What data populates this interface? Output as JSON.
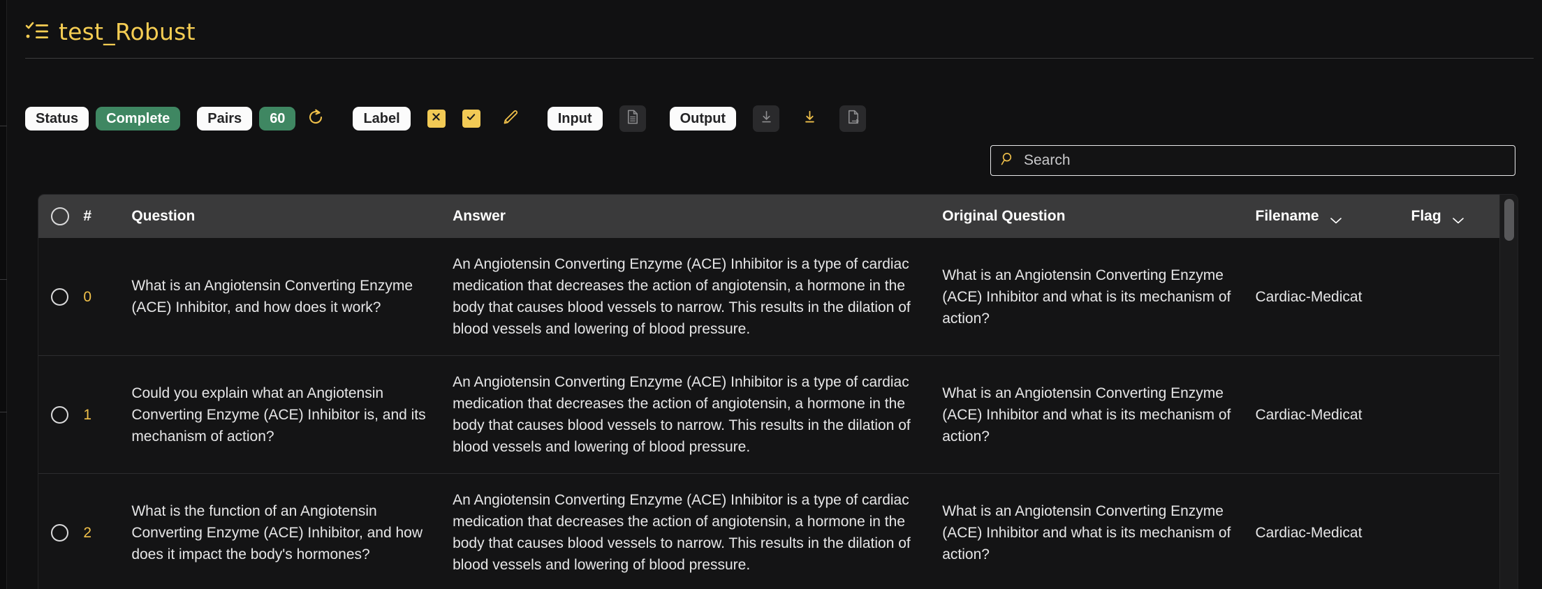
{
  "app": {
    "title": "test_Robust",
    "title_icon": "task-list-icon",
    "accent_yellow": "#f5cd53",
    "accent_green": "#3f8762",
    "background": "#111112"
  },
  "toolbar": {
    "status_label": "Status",
    "status_value": "Complete",
    "pairs_label": "Pairs",
    "pairs_value": "60",
    "refresh_icon": "refresh-icon",
    "label_label": "Label",
    "reject_icon": "cross-icon",
    "accept_icon": "check-icon",
    "edit_icon": "pencil-icon",
    "input_label": "Input",
    "input_file_icon": "file-text-icon",
    "output_label": "Output",
    "download_icon": "download-icon",
    "download_active_icon": "download-icon",
    "export_icon": "file-export-icon"
  },
  "search": {
    "icon": "search-icon",
    "placeholder": "Search",
    "value": ""
  },
  "table": {
    "select_all_icon": "radio-unchecked-icon",
    "columns": {
      "index": "#",
      "question": "Question",
      "answer": "Answer",
      "original_question": "Original Question",
      "filename": "Filename",
      "flag": "Flag"
    },
    "filename_sort_icon": "chevron-down-icon",
    "flag_sort_icon": "chevron-down-icon",
    "rows": [
      {
        "index": "0",
        "question": "What is an Angiotensin Converting Enzyme (ACE) Inhibitor, and how does it work?",
        "answer": "An Angiotensin Converting Enzyme (ACE) Inhibitor is a type of cardiac medication that decreases the action of angiotensin, a hormone in the body that causes blood vessels to narrow. This results in the dilation of blood vessels and lowering of blood pressure.",
        "original_question": "What is an Angiotensin Converting Enzyme (ACE) Inhibitor and what is its mechanism of action?",
        "filename": "Cardiac-Medicat",
        "flag": ""
      },
      {
        "index": "1",
        "question": "Could you explain what an Angiotensin Converting Enzyme (ACE) Inhibitor is, and its mechanism of action?",
        "answer": "An Angiotensin Converting Enzyme (ACE) Inhibitor is a type of cardiac medication that decreases the action of angiotensin, a hormone in the body that causes blood vessels to narrow. This results in the dilation of blood vessels and lowering of blood pressure.",
        "original_question": "What is an Angiotensin Converting Enzyme (ACE) Inhibitor and what is its mechanism of action?",
        "filename": "Cardiac-Medicat",
        "flag": ""
      },
      {
        "index": "2",
        "question": "What is the function of an Angiotensin Converting Enzyme (ACE) Inhibitor, and how does it impact the body's hormones?",
        "answer": "An Angiotensin Converting Enzyme (ACE) Inhibitor is a type of cardiac medication that decreases the action of angiotensin, a hormone in the body that causes blood vessels to narrow. This results in the dilation of blood vessels and lowering of blood pressure.",
        "original_question": "What is an Angiotensin Converting Enzyme (ACE) Inhibitor and what is its mechanism of action?",
        "filename": "Cardiac-Medicat",
        "flag": ""
      }
    ]
  }
}
